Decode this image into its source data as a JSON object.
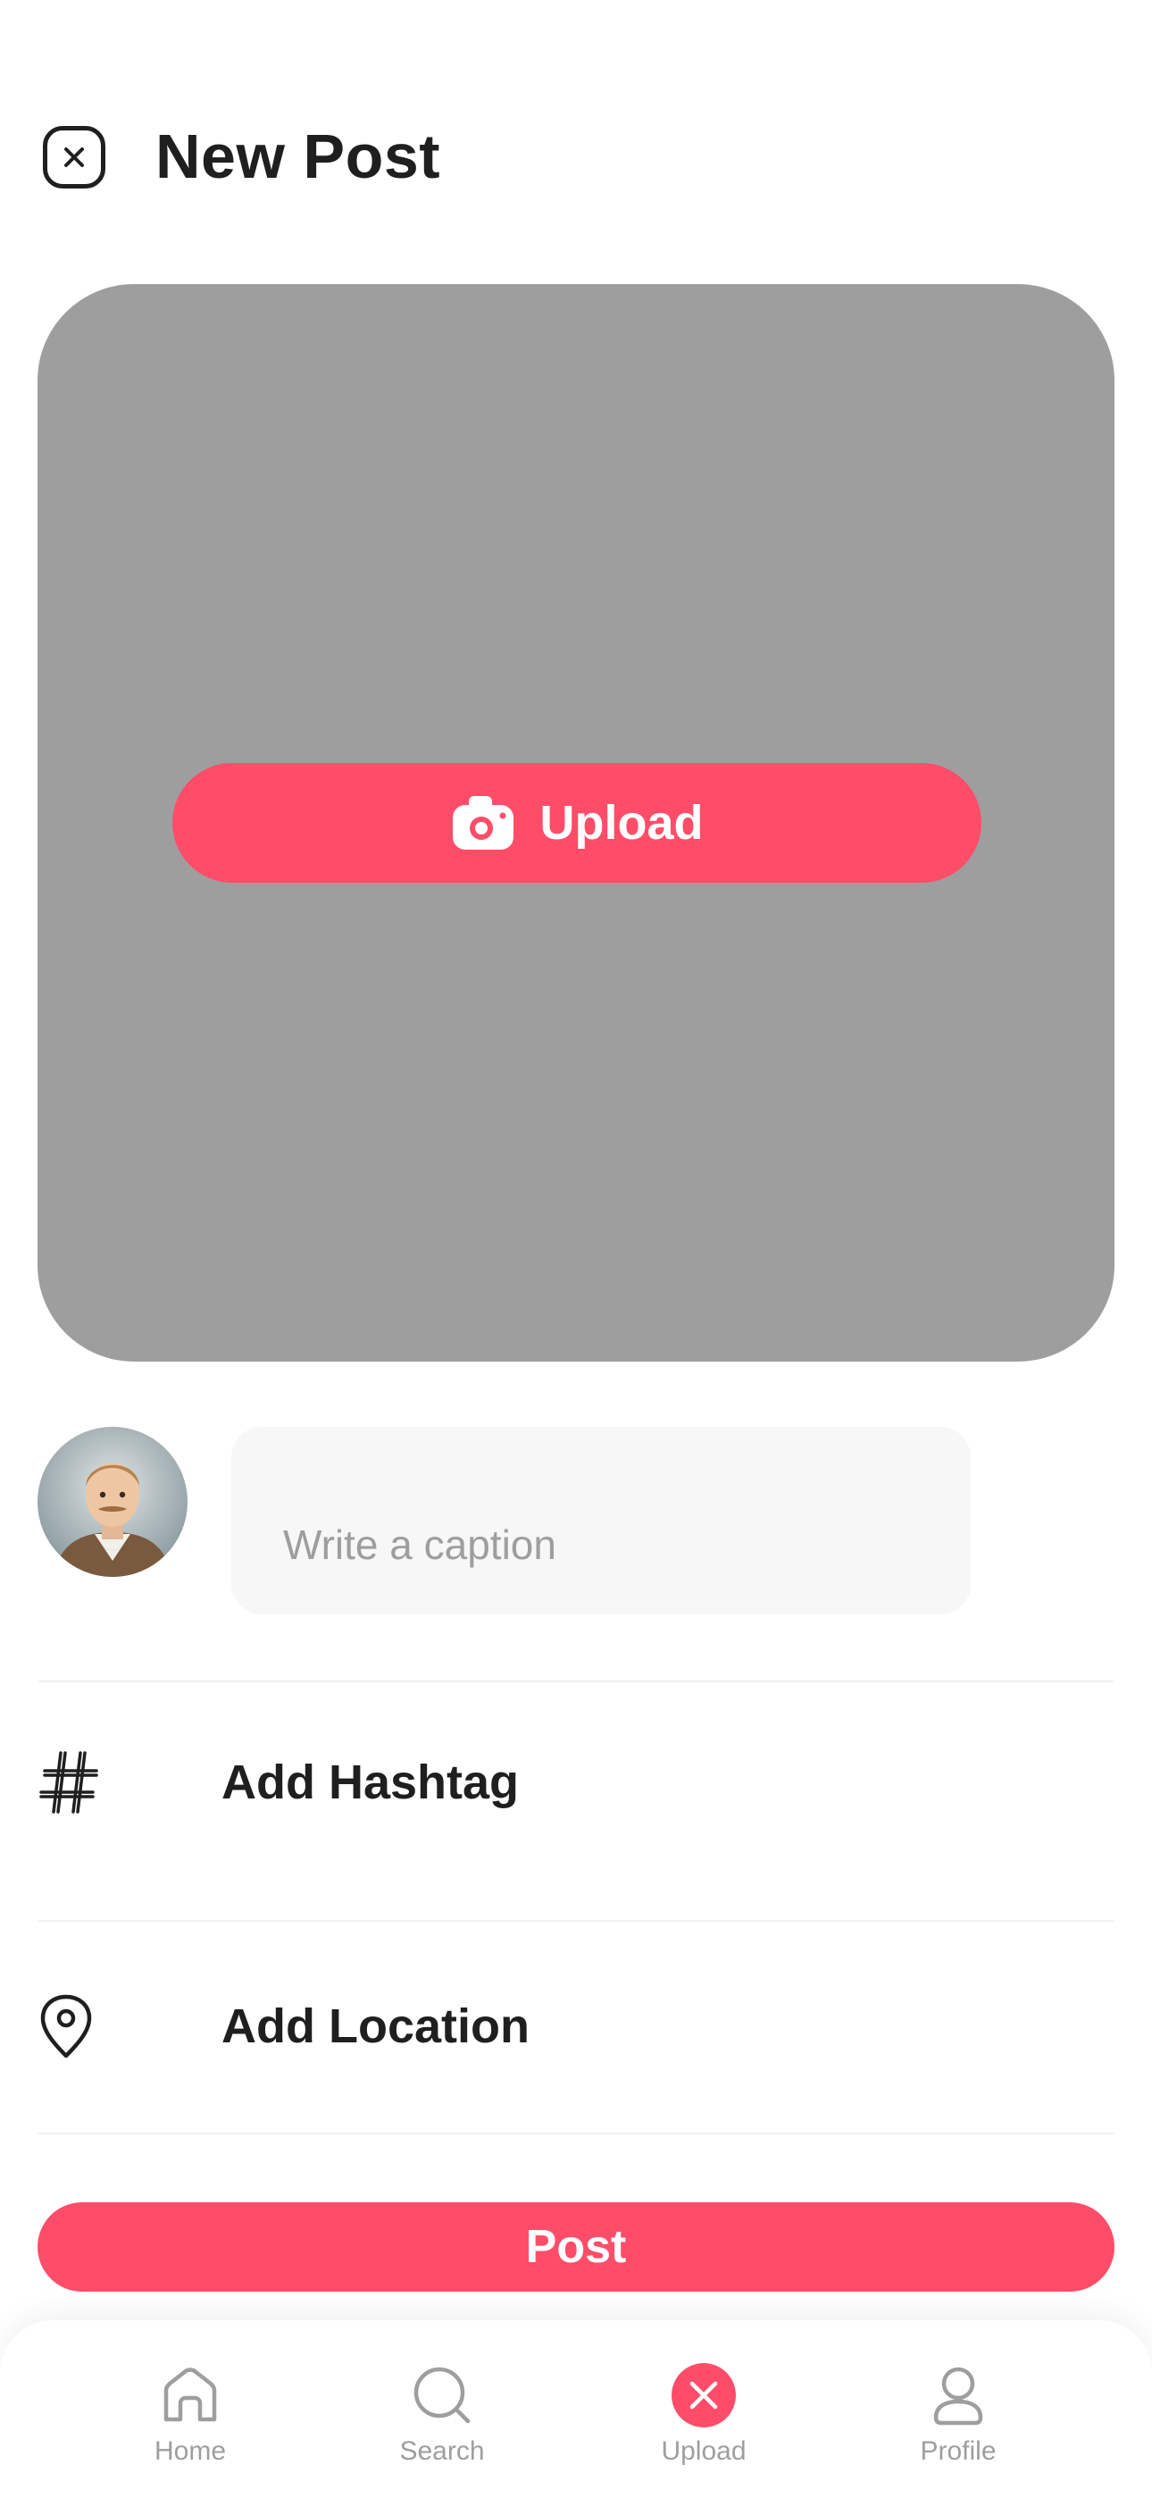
{
  "header": {
    "title": "New Post",
    "close_icon": "close-icon"
  },
  "media": {
    "upload_label": "Upload",
    "camera_icon": "camera-icon"
  },
  "caption": {
    "placeholder": "Write a caption"
  },
  "options": [
    {
      "label": "Add Hashtag",
      "icon": "hashtag-icon"
    },
    {
      "label": "Add Location",
      "icon": "location-pin-icon"
    }
  ],
  "actions": {
    "post_label": "Post"
  },
  "tabbar": {
    "items": [
      {
        "label": "Home",
        "icon": "home-icon"
      },
      {
        "label": "Search",
        "icon": "search-icon"
      },
      {
        "label": "Upload",
        "icon": "upload-close-icon"
      },
      {
        "label": "Profile",
        "icon": "profile-icon"
      }
    ]
  },
  "colors": {
    "accent": "#ff4d69",
    "media_placeholder": "#9e9e9e",
    "muted": "#9e9e9e"
  }
}
